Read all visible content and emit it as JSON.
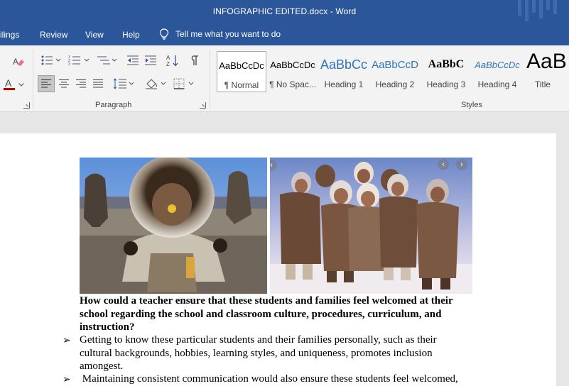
{
  "window": {
    "title": "INFOGRAPHIC EDITED.docx  -  Word"
  },
  "menu": {
    "items": [
      "ilings",
      "Review",
      "View",
      "Help"
    ],
    "tell_me": "Tell me what you want to do"
  },
  "ribbon": {
    "paragraph_label": "Paragraph",
    "styles_label": "Styles",
    "styles": [
      {
        "sample": "AaBbCcDc",
        "name": "¶ Normal"
      },
      {
        "sample": "AaBbCcDc",
        "name": "¶ No Spac..."
      },
      {
        "sample": "AaBbCc",
        "name": "Heading 1"
      },
      {
        "sample": "AaBbCcD",
        "name": "Heading 2"
      },
      {
        "sample": "AaBbC",
        "name": "Heading 3"
      },
      {
        "sample": "AaBbCcDc",
        "name": "Heading 4"
      },
      {
        "sample": "AaB",
        "name": "Title"
      }
    ],
    "icons": {
      "font_color_letter": "A",
      "font_color": "#c00000",
      "accent": "#2b579a"
    }
  },
  "document": {
    "question": [
      "How could a teacher ensure that these students and families feel welcomed at their",
      "school regarding the school and classroom culture, procedures, curriculum, and",
      "instruction?"
    ],
    "bullet1": [
      "Getting to know these particular students and their families personally, such as their",
      "cultural backgrounds, hobbies, learning styles, and uniqueness, promotes inclusion",
      "amongest."
    ],
    "bullet2": [
      " Maintaining consistent communication would also ensure these students feel welcomed,"
    ],
    "bullet_glyph": "➢"
  }
}
